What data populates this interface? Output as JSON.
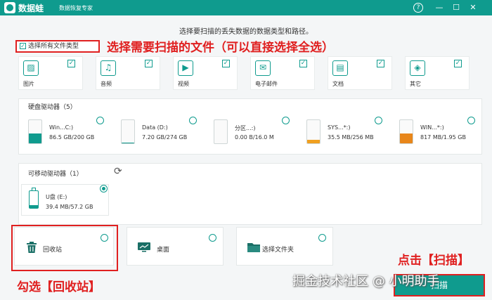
{
  "app": {
    "name": "数据蛙",
    "subtitle": "数据恢复专家"
  },
  "window_controls": {
    "help": "?",
    "minimize": "—",
    "restore": "☐",
    "close": "✕"
  },
  "hint": "选择要扫描的丢失数据的数据类型和路径。",
  "select_all": {
    "label": "选择所有文件类型",
    "checked": "✓"
  },
  "annotations": {
    "select_files": "选择需要扫描的文件（可以直接选择全选）",
    "recycle": "勾选【回收站】",
    "scan": "点击【扫描】"
  },
  "file_types": [
    {
      "label": "图片",
      "icon": "image-icon",
      "glyph": "▨",
      "checked": "✓"
    },
    {
      "label": "音频",
      "icon": "music-icon",
      "glyph": "♫",
      "checked": "✓"
    },
    {
      "label": "视频",
      "icon": "video-icon",
      "glyph": "▶",
      "checked": "✓"
    },
    {
      "label": "电子邮件",
      "icon": "mail-icon",
      "glyph": "✉",
      "checked": "✓"
    },
    {
      "label": "文档",
      "icon": "document-icon",
      "glyph": "▤",
      "checked": "✓"
    },
    {
      "label": "其它",
      "icon": "other-icon",
      "glyph": "◈",
      "checked": "✓"
    }
  ],
  "hard_drives": {
    "title": "硬盘驱动器（5）",
    "items": [
      {
        "name": "Win...C:)",
        "size": "86.5 GB/200 GB",
        "used_fraction": 0.43,
        "fill_color": "#0f9b8e"
      },
      {
        "name": "Data (D:)",
        "size": "7.20 GB/274 GB",
        "used_fraction": 0.03,
        "fill_color": "#0f9b8e"
      },
      {
        "name": "分区...:)",
        "size": "0.00  B/16.0 M",
        "used_fraction": 0.0,
        "fill_color": "#f0b030"
      },
      {
        "name": "SYS...*:)",
        "size": "35.5 MB/256 MB",
        "used_fraction": 0.14,
        "fill_color": "#f0a020"
      },
      {
        "name": "WIN...*:)",
        "size": "817 MB/1.95 GB",
        "used_fraction": 0.41,
        "fill_color": "#e8861a"
      }
    ]
  },
  "removable": {
    "title": "可移动驱动器（1）",
    "refresh_icon": "⟳",
    "items": [
      {
        "name": "U盘 (E:)",
        "size": "39.4 MB/57.2 GB"
      }
    ]
  },
  "locations": [
    {
      "label": "回收站",
      "icon": "recycle-bin-icon"
    },
    {
      "label": "桌面",
      "icon": "desktop-icon"
    },
    {
      "label": "选择文件夹",
      "icon": "folder-icon"
    }
  ],
  "scan_button": {
    "label": "扫描"
  },
  "watermark": "掘金技术社区 @ 小明助手",
  "colors": {
    "accent": "#0f9b8e",
    "annotation": "#e02020"
  }
}
